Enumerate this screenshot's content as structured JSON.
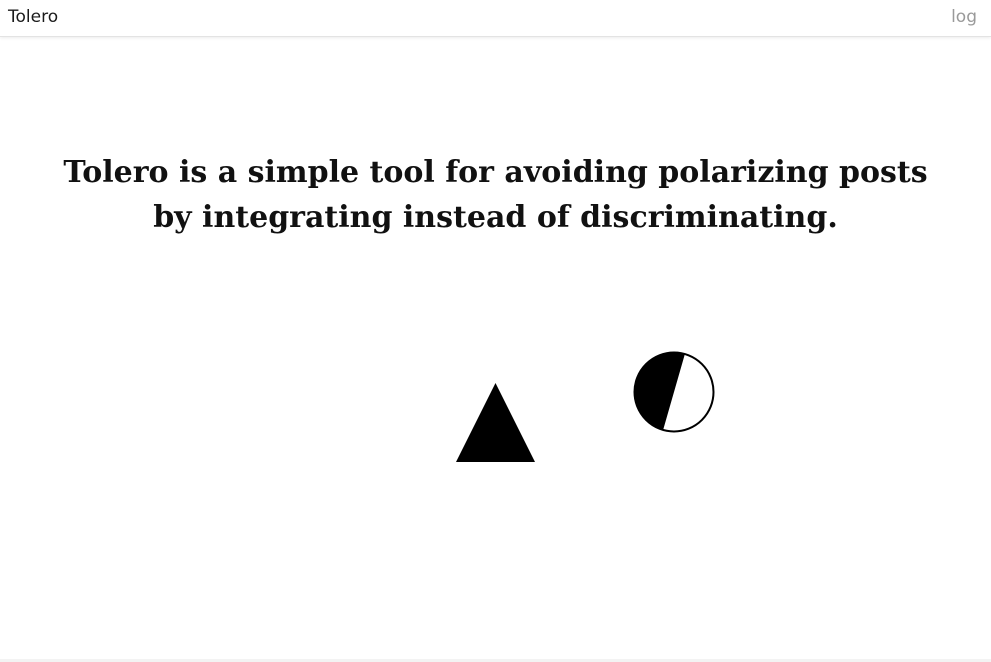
{
  "header": {
    "brand": "Tolero",
    "log_label": "log"
  },
  "main": {
    "tagline_line1": "Tolero is a simple tool for avoiding polarizing posts",
    "tagline_line2": "by integrating instead of discriminating."
  },
  "icons": {
    "triangle": "triangle-icon",
    "circle": "half-filled-circle-icon"
  },
  "colors": {
    "text": "#111111",
    "muted": "#9a9a9a",
    "shape_fill": "#000000",
    "background": "#ffffff"
  }
}
